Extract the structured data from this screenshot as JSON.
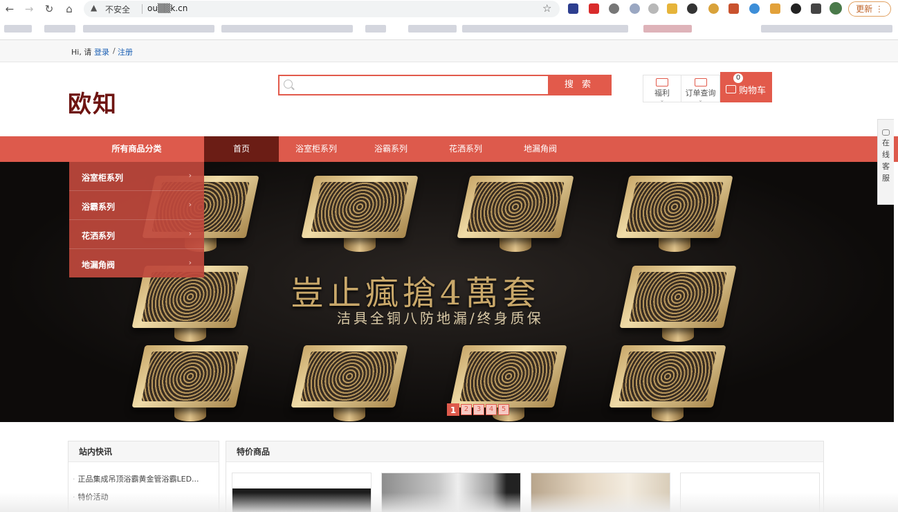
{
  "browser": {
    "insecure_label": "不安全",
    "url": "ou▒▒k.cn",
    "update_label": "更新"
  },
  "userbar": {
    "greeting": "Hi, 请",
    "login": "登录",
    "separator": "/",
    "register": "注册"
  },
  "header": {
    "logo": "欧知",
    "search_placeholder": "",
    "search_button": "搜 索",
    "welfare": "福利",
    "order_query": "订单查询",
    "cart_label": "购物车",
    "cart_count": "0"
  },
  "nav": {
    "all_categories": "所有商品分类",
    "items": [
      {
        "label": "首页",
        "active": true
      },
      {
        "label": "浴室柜系列",
        "active": false
      },
      {
        "label": "浴霸系列",
        "active": false
      },
      {
        "label": "花洒系列",
        "active": false
      },
      {
        "label": "地漏角阀",
        "active": false
      }
    ]
  },
  "category_menu": [
    {
      "label": "浴室柜系列",
      "arrow": "›"
    },
    {
      "label": "浴霸系列",
      "arrow": "›"
    },
    {
      "label": "花洒系列",
      "arrow": "›"
    },
    {
      "label": "地漏角阀",
      "arrow": "›"
    }
  ],
  "banner": {
    "title": "豈止瘋搶4萬套",
    "subtitle": "洁具全铜八防地漏/终身质保",
    "pages": [
      "1",
      "2",
      "3",
      "4",
      "5"
    ],
    "active_page": 1
  },
  "service": {
    "chars": [
      "在",
      "线",
      "客",
      "服"
    ]
  },
  "news": {
    "title": "站内快讯",
    "items": [
      "正品集成吊顶浴霸黄金管浴霸LED...",
      "特价活动"
    ]
  },
  "deals": {
    "title": "特价商品"
  },
  "colors": {
    "accent": "#dd5a4c",
    "nav_active": "#6b1d15",
    "logo": "#6e1411",
    "link": "#1a5fb4"
  }
}
